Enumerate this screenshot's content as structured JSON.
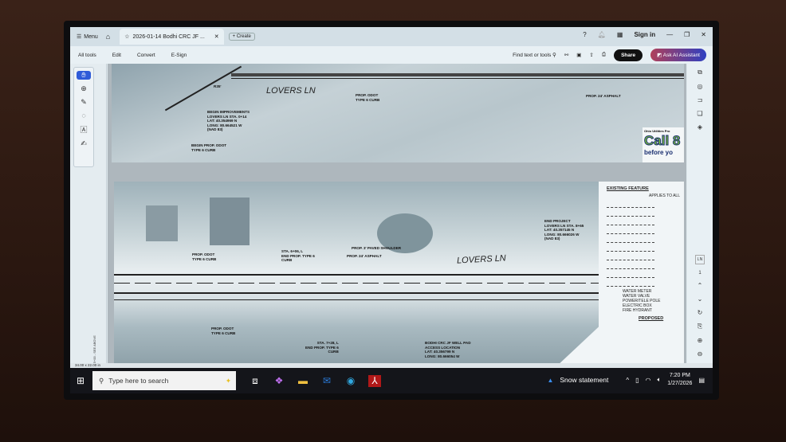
{
  "titlebar": {
    "menu_label": "Menu",
    "tab_title": "2026-01-14 Bodhi CRC JF ...",
    "create_label": "Create",
    "sign_in": "Sign in"
  },
  "toolbar": {
    "items": [
      "All tools",
      "Edit",
      "Convert",
      "E-Sign"
    ],
    "find_label": "Find text or tools",
    "share_label": "Share",
    "ai_label": "Ask AI Assistant"
  },
  "page1": {
    "street": "LOVERS LN",
    "radius": "R35'",
    "begin_improvements": "BEGIN IMPROVEMENTS\nLOVERS LN STA. 0+14\nLAT: 40.354969 N\nLONG: 80.664521 W\n(NAD 83)",
    "begin_curb": "BEGIN PROP. ODOT\nTYPE 6 CURB",
    "curb": "PROP. ODOT\nTYPE 6 CURB",
    "asphalt": "PROP. 24' ASPHALT",
    "call_header": "Ohio Utilities Pro",
    "call_big": "Call 8",
    "call_small": "before yo"
  },
  "page2": {
    "street": "LOVERS LN",
    "curb_a": "PROP. ODOT\nTYPE 6 CURB",
    "sta_a": "STA. 6+06, L\nEND PROP. TYPE 6\nCURB",
    "shoulder": "PROP. 3' PAVED SHOULDER",
    "asphalt": "PROP. 24' ASPHALT",
    "curb_b": "PROP. ODOT\nTYPE 6 CURB",
    "sta_b": "STA. 7+28, L\nEND PROP. TYPE 6\nCURB",
    "well_pad": "BODHI CRC JF WELL PAD\nACCESS LOCATION\nLAT: 40.356799 N\nLONG: 80.666054 W",
    "end_project": "END PROJECT\nLOVERS LN STA. 8+65\nLAT: 40.357145 N\nLONG: 80.666026 W\n(NAD 83)",
    "matchline": "MATCHLINE STA. 5+00 - SEE ABOVE",
    "legend": {
      "existing_title": "EXISTING FEATURE",
      "applies": "APPLIES TO ALL",
      "items": [
        "WATER METER",
        "WATER VALVE",
        "POWER/TELE POLE",
        "ELECTRIC BOX",
        "FIRE HYDRANT"
      ],
      "proposed_title": "PROPOSED"
    }
  },
  "rightrail": {
    "page_label": "LN",
    "page_number": "1"
  },
  "statusbar": {
    "page_size": "34.00 x 22.00 in"
  },
  "taskbar": {
    "search_placeholder": "Type here to search",
    "weather": "Snow statement",
    "time": "7:20 PM",
    "date": "1/27/2026"
  }
}
